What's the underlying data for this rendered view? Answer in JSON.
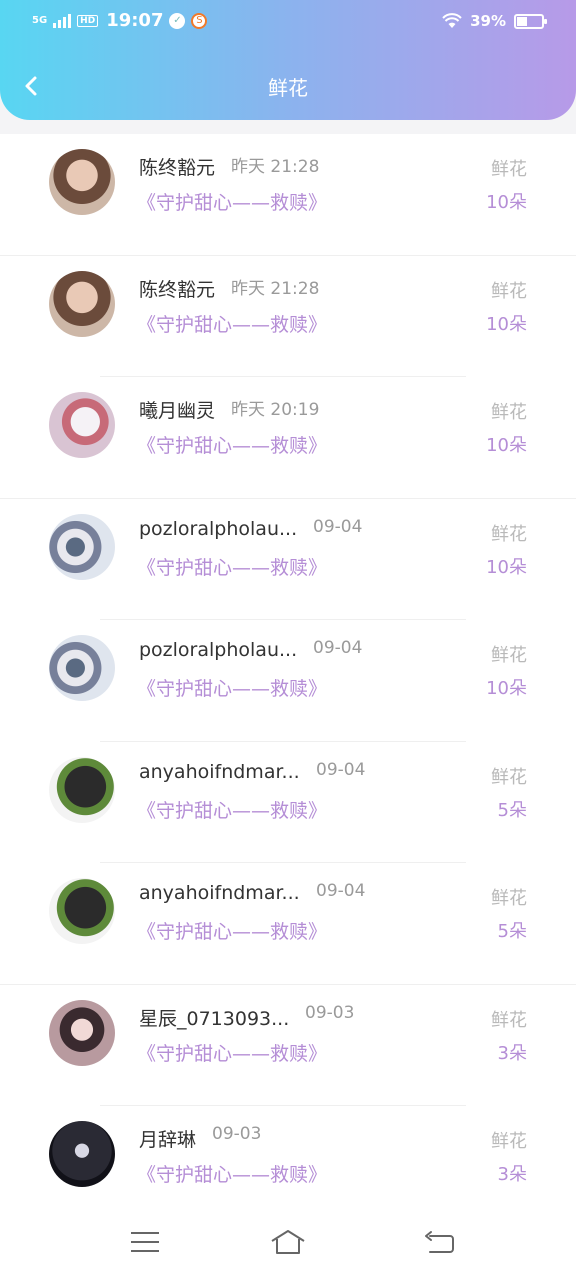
{
  "status_bar": {
    "network": "5G",
    "hd": "HD",
    "time": "19:07",
    "battery": "39%",
    "battery_level": 0.39
  },
  "header": {
    "title": "鲜花",
    "back_icon": "chevron-left-icon"
  },
  "rows": [
    {
      "name": "陈终豁元",
      "date": "昨天 21:28",
      "gift": "《守护甜心——救赎》",
      "label": "鲜花",
      "count": "10朵",
      "avatar": "woman-portrait"
    },
    {
      "name": "陈终豁元",
      "date": "昨天 21:28",
      "gift": "《守护甜心——救赎》",
      "label": "鲜花",
      "count": "10朵",
      "avatar": "woman-portrait"
    },
    {
      "name": "曦月幽灵",
      "date": "昨天 20:19",
      "gift": "《守护甜心——救赎》",
      "label": "鲜花",
      "count": "10朵",
      "avatar": "rabbit-figure"
    },
    {
      "name": "pozloralpholau...",
      "date": "09-04",
      "gift": "《守护甜心——救赎》",
      "label": "鲜花",
      "count": "10朵",
      "avatar": "two-kids"
    },
    {
      "name": "pozloralpholau...",
      "date": "09-04",
      "gift": "《守护甜心——救赎》",
      "label": "鲜花",
      "count": "10朵",
      "avatar": "two-kids"
    },
    {
      "name": "anyahoifndmar...",
      "date": "09-04",
      "gift": "《守护甜心——救赎》",
      "label": "鲜花",
      "count": "5朵",
      "avatar": "green-object"
    },
    {
      "name": "anyahoifndmar...",
      "date": "09-04",
      "gift": "《守护甜心——救赎》",
      "label": "鲜花",
      "count": "5朵",
      "avatar": "green-object"
    },
    {
      "name": "星辰_0713093...",
      "date": "09-03",
      "gift": "《守护甜心——救赎》",
      "label": "鲜花",
      "count": "3朵",
      "avatar": "anime-girl"
    },
    {
      "name": "月辞琳",
      "date": "09-03",
      "gift": "《守护甜心——救赎》",
      "label": "鲜花",
      "count": "3朵",
      "avatar": "dark-selfie"
    }
  ],
  "bottom_nav": {
    "menu_icon": "menu-icon",
    "home_icon": "home-icon",
    "back_icon": "return-icon"
  },
  "colors": {
    "header_start": "#58d6f2",
    "header_end": "#b79ae8",
    "accent": "#b58ed6"
  }
}
